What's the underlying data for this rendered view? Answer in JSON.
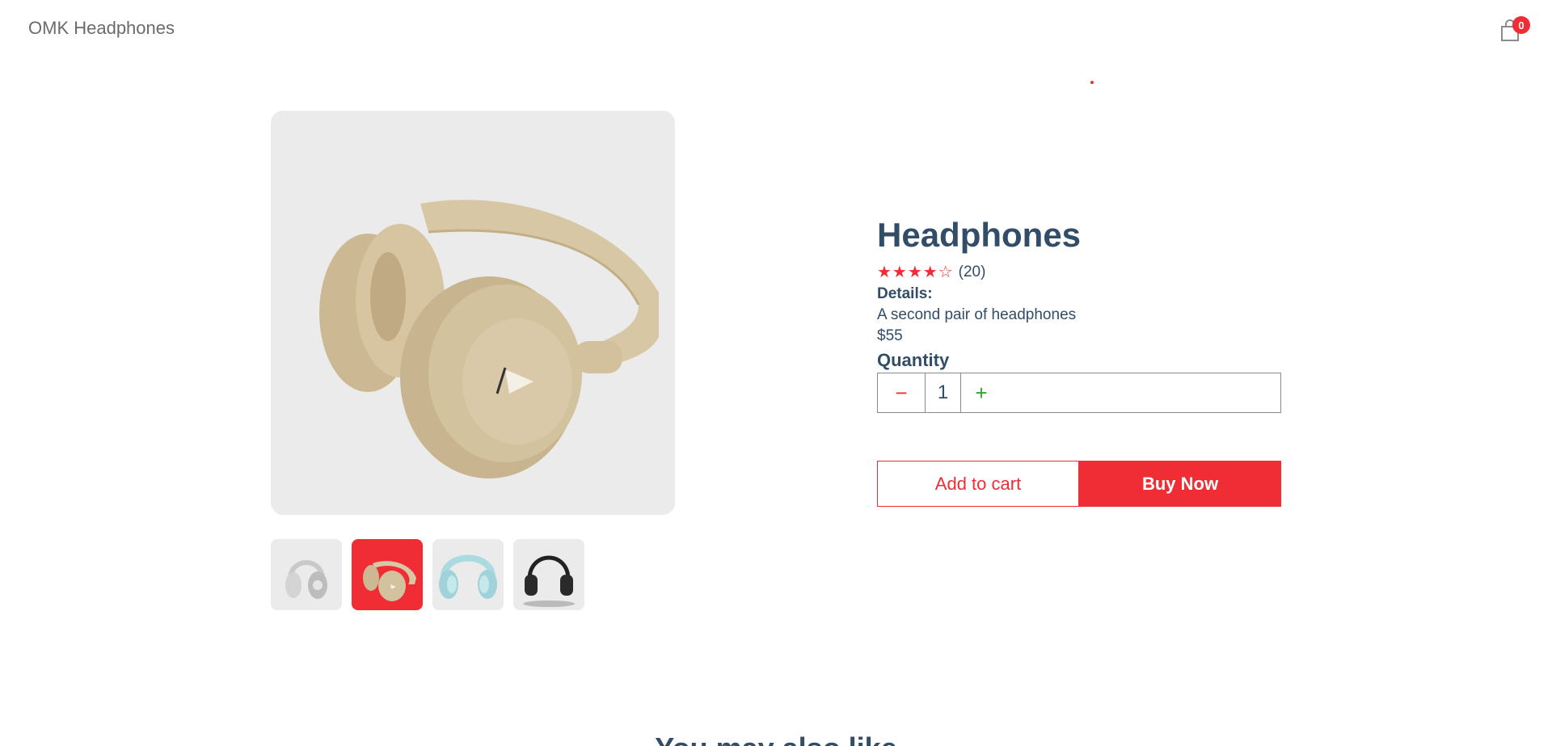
{
  "navbar": {
    "logo": "OMK Headphones",
    "cart_count": "0"
  },
  "product": {
    "name": "Headphones",
    "rating_stars": "★★★★☆",
    "review_count": "(20)",
    "details_label": "Details:",
    "description": "A second pair of headphones",
    "price": "$55"
  },
  "quantity": {
    "label": "Quantity",
    "minus": "−",
    "value": "1",
    "plus": "+"
  },
  "actions": {
    "add_to_cart": "Add to cart",
    "buy_now": "Buy Now"
  },
  "section": {
    "heading": "You may also like"
  },
  "thumbnails": [
    {
      "name": "white-headphones",
      "selected": false
    },
    {
      "name": "beige-headphones",
      "selected": true
    },
    {
      "name": "light-blue-headphones",
      "selected": false
    },
    {
      "name": "black-headphones",
      "selected": false
    }
  ],
  "colors": {
    "accent": "#f02d34",
    "text": "#324d67",
    "plus": "#31a831",
    "image_bg": "#ebebeb"
  }
}
